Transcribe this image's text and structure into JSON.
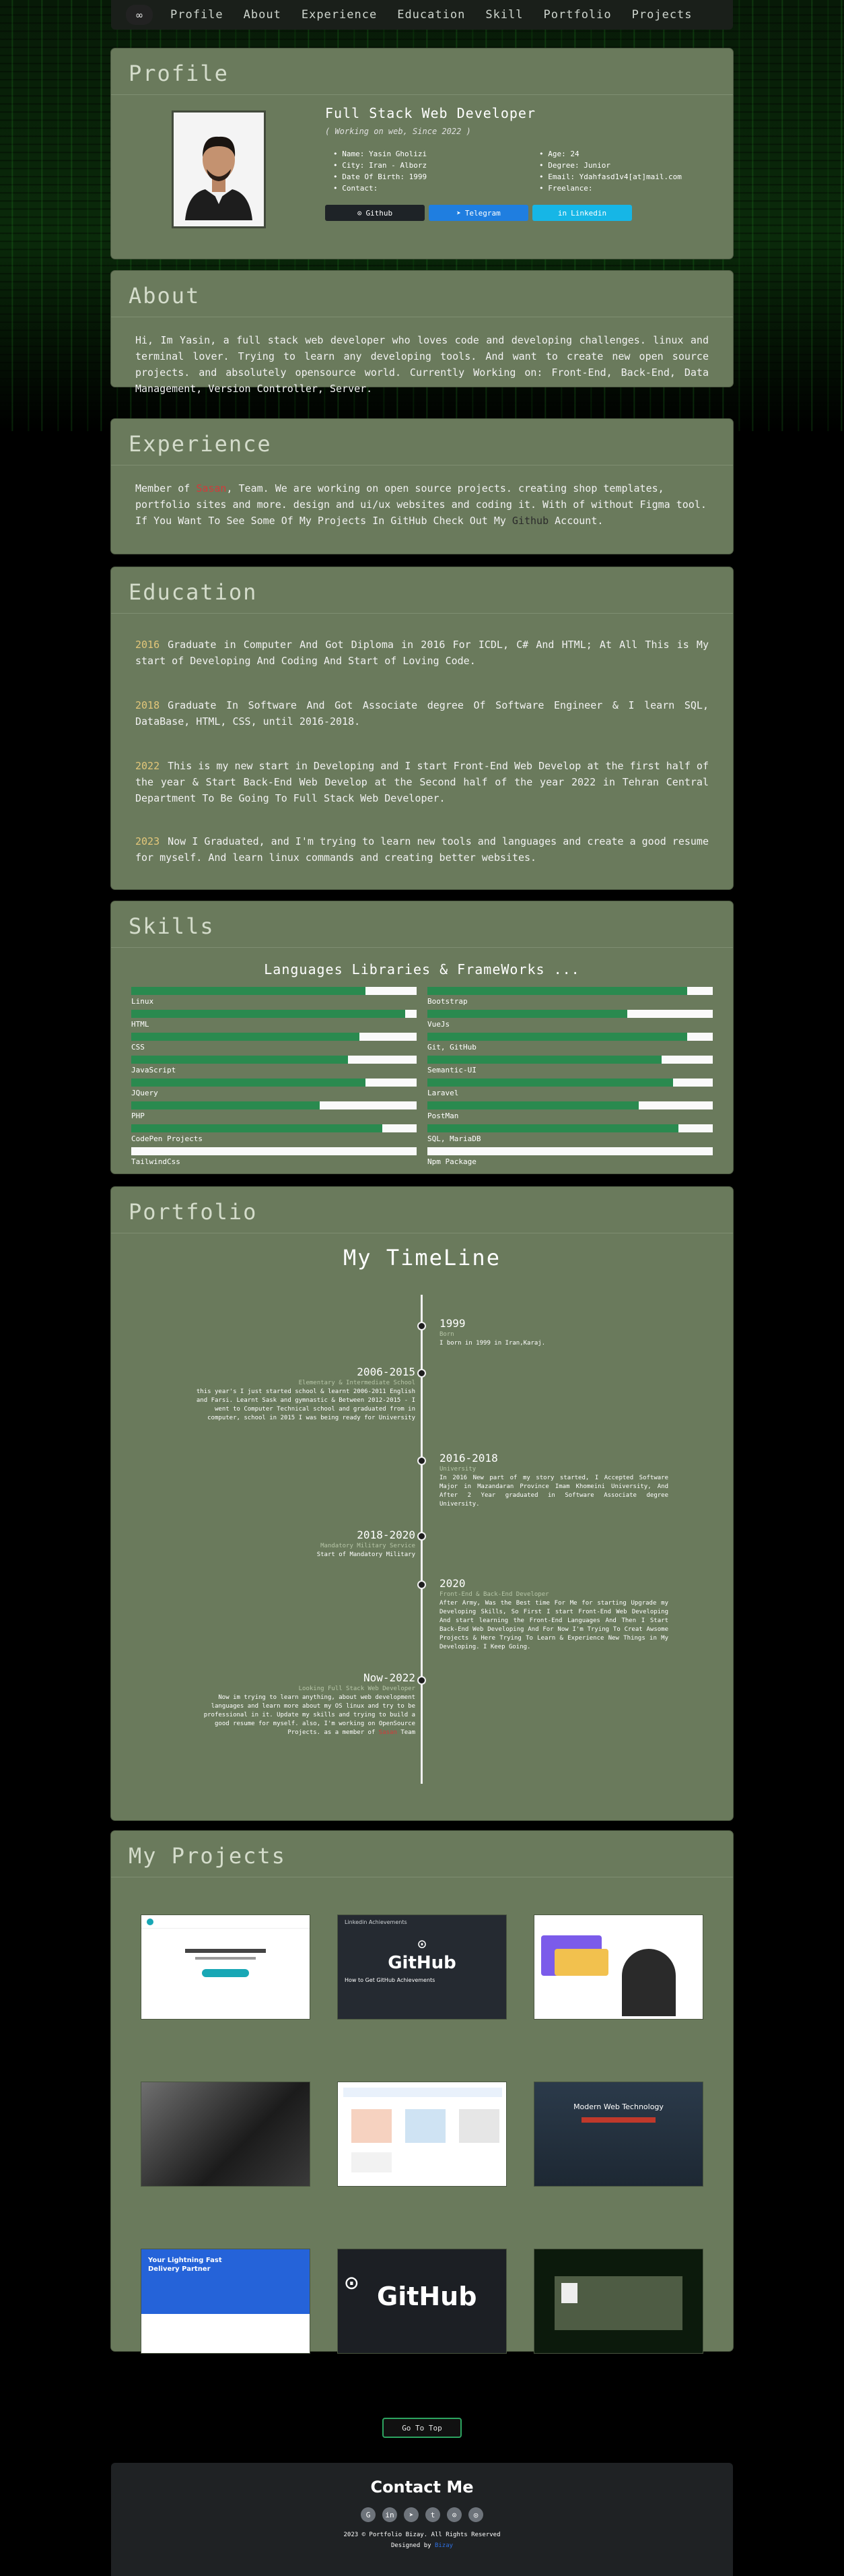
{
  "nav": {
    "logo_icon": "infinity-icon",
    "links": [
      "Profile",
      "About",
      "Experience",
      "Education",
      "Skill",
      "Portfolio",
      "Projects"
    ]
  },
  "profile": {
    "heading": "Profile",
    "title": "Full Stack Web Developer",
    "subtitle": "( Working on web, Since 2022 )",
    "facts_left": [
      "Name: Yasin Gholizi",
      "City: Iran - Alborz",
      "Date Of Birth: 1999",
      "Contact:"
    ],
    "facts_right": [
      "Age: 24",
      "Degree: Junior",
      "Email: Ydahfasd1v4[at]mail.com",
      "Freelance:"
    ],
    "buttons": [
      {
        "label": "Github",
        "icon": "github-icon",
        "color": "#1e2327"
      },
      {
        "label": "Telegram",
        "icon": "telegram-icon",
        "color": "#1f7ee0"
      },
      {
        "label": "Linkedin",
        "icon": "linkedin-icon",
        "color": "#16b6e6"
      }
    ]
  },
  "about": {
    "heading": "About",
    "text": "Hi, Im Yasin, a full stack web developer who loves code and developing challenges. linux and terminal lover. Trying to learn any developing tools. And want to create new open source projects. and absolutely opensource world. Currently Working on: Front-End, Back-End, Data Management, Version Controller, Server."
  },
  "experience": {
    "heading": "Experience",
    "line1_a": "Member of",
    "line1_team": "Sasan",
    "line1_b": "Team. We are working on open source projects. creating shop templates, portfolio sites and more. design and ui/ux websites and coding it. With of without Figma tool.",
    "line2_a": "If You Want To See Some Of My Projects In GitHub Check Out My",
    "line2_link": "Github",
    "line2_b": "Account."
  },
  "education": {
    "heading": "Education",
    "items": [
      {
        "year": "2016",
        "text": "Graduate in Computer And Got Diploma in 2016 For ICDL, C# And HTML; At All This is My start of Developing And Coding And Start of Loving Code."
      },
      {
        "year": "2018",
        "text": "Graduate In Software And Got Associate degree Of Software Engineer & I learn SQL, DataBase, HTML, CSS, until 2016-2018."
      },
      {
        "year": "2022",
        "text": "This is my new start in Developing and I start Front-End Web Develop at the first half of the year & Start Back-End Web Develop at the Second half of the year 2022 in Tehran Central Department To Be Going To Full Stack Web Developer."
      },
      {
        "year": "2023",
        "text": "Now I Graduated, and I'm trying to learn new tools and languages and create a good resume for myself. And learn linux commands and creating better websites."
      }
    ]
  },
  "skills": {
    "heading": "Skills",
    "subheading": "Languages Libraries & FrameWorks ...",
    "left": [
      {
        "name": "Linux",
        "level": 0.82
      },
      {
        "name": "HTML",
        "level": 0.96
      },
      {
        "name": "CSS",
        "level": 0.8
      },
      {
        "name": "JavaScript",
        "level": 0.76
      },
      {
        "name": "JQuery",
        "level": 0.82
      },
      {
        "name": "PHP",
        "level": 0.66
      },
      {
        "name": "CodePen Projects",
        "level": 0.88
      },
      {
        "name": "TailwindCss",
        "level": 0.0
      }
    ],
    "right": [
      {
        "name": "Bootstrap",
        "level": 0.91
      },
      {
        "name": "VueJs",
        "level": 0.7
      },
      {
        "name": "Git, GitHub",
        "level": 0.91
      },
      {
        "name": "Semantic-UI",
        "level": 0.82
      },
      {
        "name": "Laravel",
        "level": 0.86
      },
      {
        "name": "PostMan",
        "level": 0.74
      },
      {
        "name": "SQL, MariaDB",
        "level": 0.88
      },
      {
        "name": "Npm Package",
        "level": 0.0
      }
    ]
  },
  "portfolio": {
    "heading": "Portfolio",
    "title": "My TimeLine",
    "events": [
      {
        "year": "1999",
        "sub": "Born",
        "text": "I born in 1999 in Iran,Karaj.",
        "side": "right"
      },
      {
        "year": "2006-2015",
        "sub": "Elementary & Intermediate School",
        "text": "this year's I just started school & learnt 2006-2011 English and Farsi. Learnt Sask and gymnastic & Between 2012-2015 - I went to Computer Technical school and graduated from in computer, school in 2015 I was being ready for University",
        "side": "left"
      },
      {
        "year": "2016-2018",
        "sub": "University",
        "text": "In 2016 New part of my story started, I Accepted Software Major in Mazandaran Province Imam Khomeini University, And After 2 Year graduated in Software Associate degree University.",
        "side": "right"
      },
      {
        "year": "2018-2020",
        "sub": "Mandatory Military Service",
        "text": "Start of Mandatory Military",
        "side": "left"
      },
      {
        "year": "2020",
        "sub": "Front-End & Back-End Developer",
        "text": "After Army, Was the Best time For Me for starting Upgrade my Developing Skills, So First I start Front-End Web Developing And start learning the Front-End Languages And Then I Start Back-End Web Developing And For Now I'm Trying To Creat Awsome Projects & Here Trying To Learn & Experience New Things in My Developing. I Keep Going.",
        "side": "right"
      },
      {
        "year": "Now-2022",
        "sub": "Looking Full Stack Web Developer",
        "text": "Now im trying to learn anything, about web development languages and learn more about my OS linux and try to be professional in it. Update my skills and trying to build a good resume for myself. also, I'm working on OpenSource Projects. as a member of",
        "text_team": "Sasan",
        "text_end": "Team",
        "side": "left"
      }
    ]
  },
  "projects": {
    "heading": "My Projects",
    "items": [
      {
        "kind": "web-template-rtl"
      },
      {
        "kind": "github-article"
      },
      {
        "kind": "portfolio-landing"
      },
      {
        "kind": "dark-photo"
      },
      {
        "kind": "ecommerce-app"
      },
      {
        "kind": "dark-web-technology"
      },
      {
        "kind": "delivery-landing"
      },
      {
        "kind": "github-code"
      },
      {
        "kind": "matrix-portfolio"
      }
    ],
    "snippets": {
      "github_word": "GitHub",
      "github_heading": "Linkedin Achievements",
      "github_sub": "How to Get GitHub Achievements",
      "delivery_title": "Your Lightning Fast Delivery Partner",
      "web_tech_title": "Modern Web Technology"
    }
  },
  "footer": {
    "top_button": "Go To Top",
    "heading": "Contact Me",
    "socials": [
      "google-icon",
      "linkedin-icon",
      "telegram-icon",
      "twitter-icon",
      "github-icon",
      "dribbble-icon"
    ],
    "copyright": "2023 © Portfolio Bizay. All Rights Reserved",
    "designed_by": "Designed by",
    "designer": "Bizay"
  }
}
